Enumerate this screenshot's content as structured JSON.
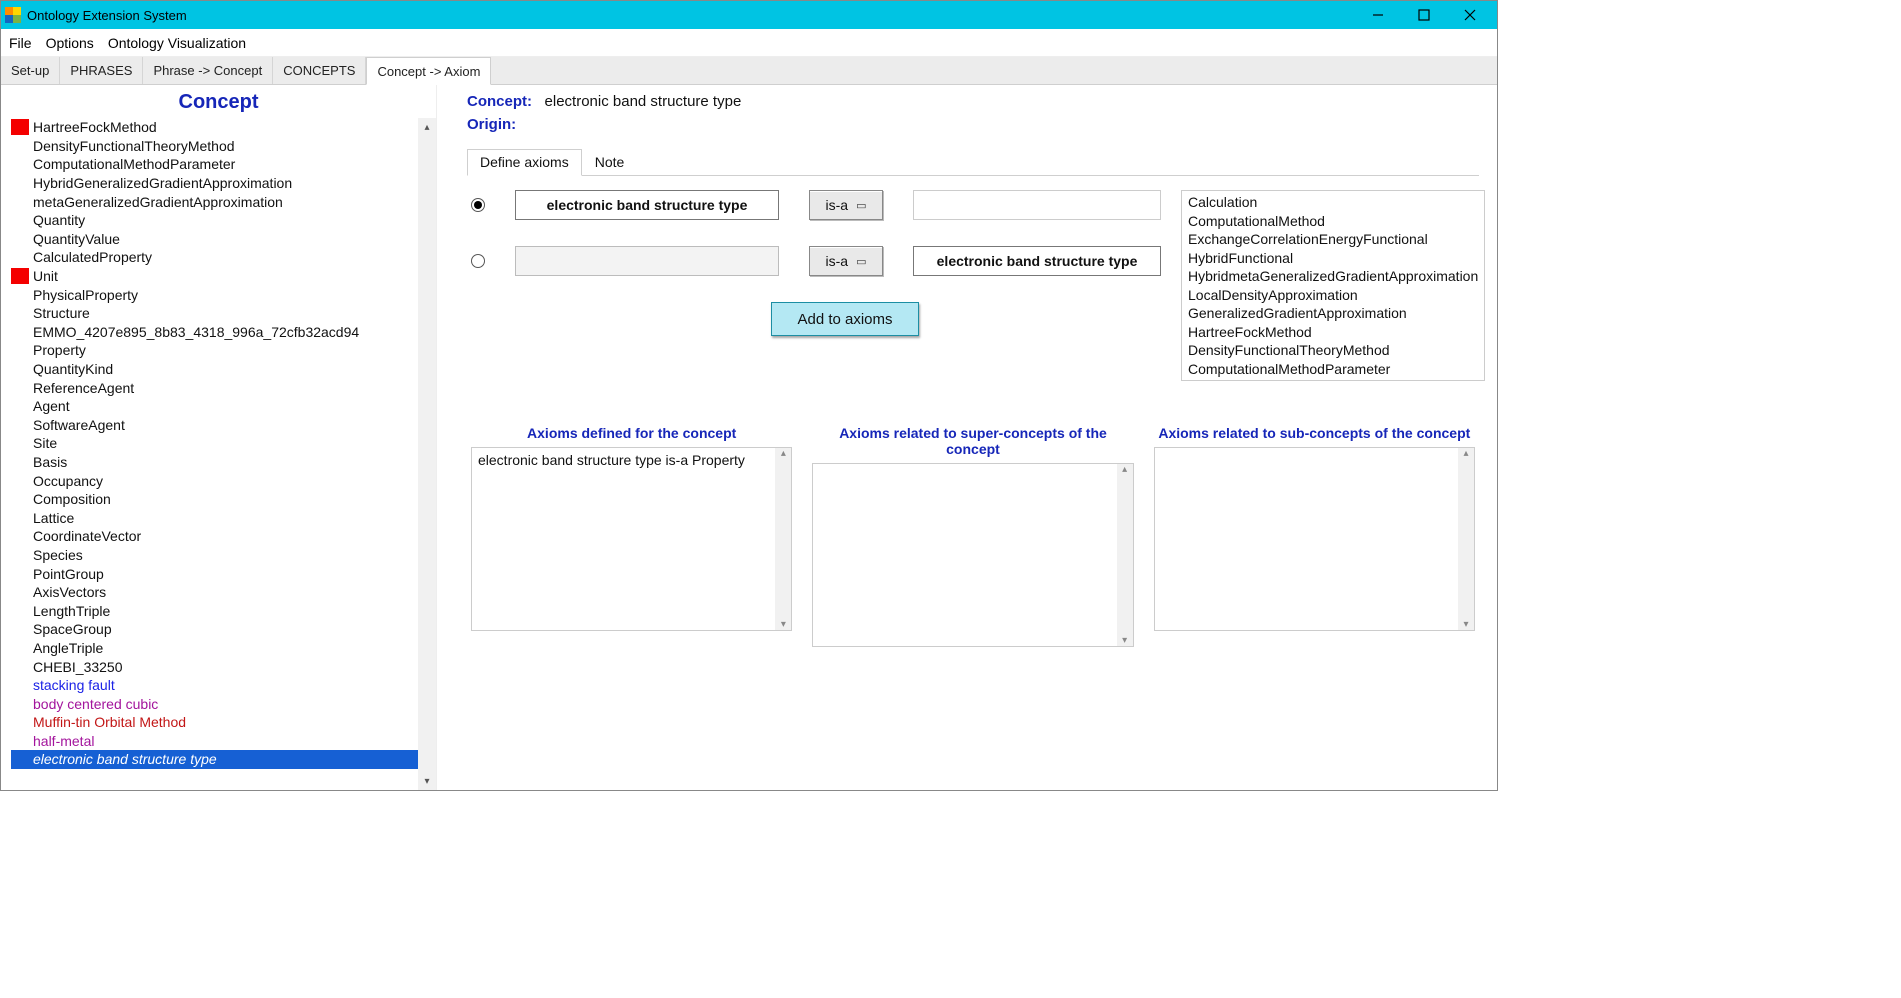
{
  "window": {
    "title": "Ontology Extension System"
  },
  "menus": {
    "file": "File",
    "options": "Options",
    "viz": "Ontology Visualization"
  },
  "tabs": {
    "setup": "Set-up",
    "phrases": "PHRASES",
    "p2c": "Phrase -> Concept",
    "concepts": "CONCEPTS",
    "c2a": "Concept -> Axiom"
  },
  "left": {
    "heading": "Concept",
    "items": [
      {
        "label": "HartreeFockMethod",
        "marker": true,
        "cls": "black"
      },
      {
        "label": "DensityFunctionalTheoryMethod",
        "cls": "black"
      },
      {
        "label": "ComputationalMethodParameter",
        "cls": "black"
      },
      {
        "label": "HybridGeneralizedGradientApproximation",
        "cls": "black"
      },
      {
        "label": "metaGeneralizedGradientApproximation",
        "cls": "black"
      },
      {
        "label": "Quantity",
        "cls": "black"
      },
      {
        "label": "QuantityValue",
        "cls": "black"
      },
      {
        "label": "CalculatedProperty",
        "cls": "black"
      },
      {
        "label": "Unit",
        "marker": true,
        "cls": "black"
      },
      {
        "label": "PhysicalProperty",
        "cls": "black"
      },
      {
        "label": "Structure",
        "cls": "black"
      },
      {
        "label": "EMMO_4207e895_8b83_4318_996a_72cfb32acd94",
        "cls": "black"
      },
      {
        "label": "Property",
        "cls": "black"
      },
      {
        "label": "QuantityKind",
        "cls": "black"
      },
      {
        "label": "ReferenceAgent",
        "cls": "black"
      },
      {
        "label": "Agent",
        "cls": "black"
      },
      {
        "label": "SoftwareAgent",
        "cls": "black"
      },
      {
        "label": "Site",
        "cls": "black"
      },
      {
        "label": "Basis",
        "cls": "black"
      },
      {
        "label": "Occupancy",
        "cls": "black"
      },
      {
        "label": "Composition",
        "cls": "black"
      },
      {
        "label": "Lattice",
        "cls": "black"
      },
      {
        "label": "CoordinateVector",
        "cls": "black"
      },
      {
        "label": "Species",
        "cls": "black"
      },
      {
        "label": "PointGroup",
        "cls": "black"
      },
      {
        "label": "AxisVectors",
        "cls": "black"
      },
      {
        "label": "LengthTriple",
        "cls": "black"
      },
      {
        "label": "SpaceGroup",
        "cls": "black"
      },
      {
        "label": "AngleTriple",
        "cls": "black"
      },
      {
        "label": "CHEBI_33250",
        "cls": "black"
      },
      {
        "label": "stacking fault",
        "cls": "blue"
      },
      {
        "label": "body centered cubic",
        "cls": "purp"
      },
      {
        "label": "Muffin-tin Orbital Method",
        "cls": "red"
      },
      {
        "label": "half-metal",
        "cls": "purp"
      },
      {
        "label": "electronic band structure type",
        "cls": "sel",
        "selected": true
      }
    ]
  },
  "right": {
    "concept_label": "Concept:",
    "concept_value": "electronic band structure type",
    "origin_label": "Origin:",
    "subtabs": {
      "define": "Define axioms",
      "note": "Note"
    },
    "row1_subject": "electronic band structure type",
    "row2_object": "electronic band structure type",
    "relation": "is-a",
    "add_button": "Add to axioms",
    "candidates": [
      "Calculation",
      "ComputationalMethod",
      "ExchangeCorrelationEnergyFunctional",
      "HybridFunctional",
      "HybridmetaGeneralizedGradientApproximation",
      "LocalDensityApproximation",
      "GeneralizedGradientApproximation",
      "HartreeFockMethod",
      "DensityFunctionalTheoryMethod",
      "ComputationalMethodParameter"
    ],
    "cols": {
      "defined": "Axioms defined for the concept",
      "super": "Axioms related to super-concepts of the concept",
      "sub": "Axioms related to sub-concepts of the concept"
    },
    "defined_axioms": [
      "electronic band structure type is-a Property"
    ]
  }
}
